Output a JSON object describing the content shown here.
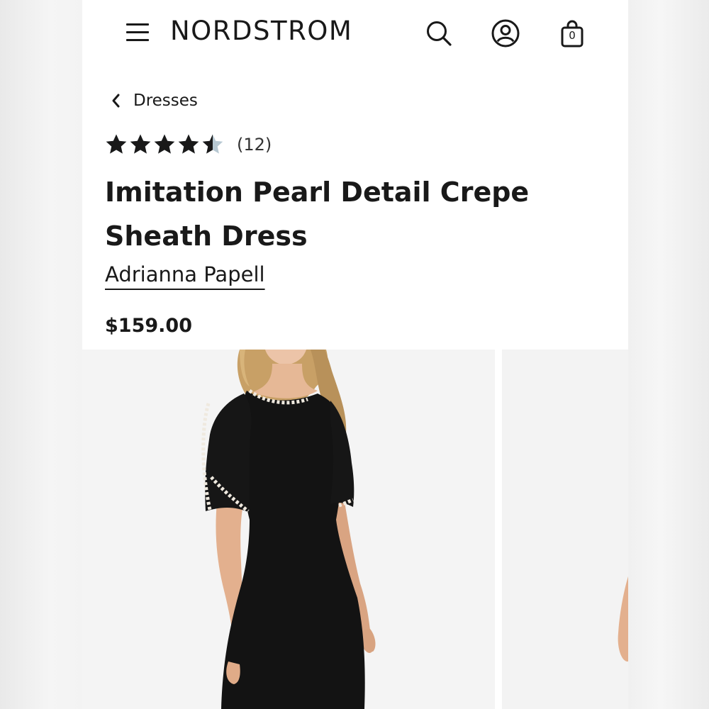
{
  "header": {
    "logo": "NORDSTROM",
    "bag_count": "0",
    "icons": [
      "menu-icon",
      "search-icon",
      "account-icon",
      "shopping-bag-icon"
    ]
  },
  "breadcrumb": {
    "label": "Dresses"
  },
  "product": {
    "rating": 4.5,
    "max_rating": 5,
    "review_count": "(12)",
    "title": "Imitation Pearl Detail Crepe Sheath Dress",
    "brand": "Adrianna Papell",
    "price": "$159.00"
  },
  "gallery": {
    "images": [
      "main-product-image",
      "next-product-image"
    ]
  },
  "colors": {
    "text": "#191919",
    "star_filled": "#191919",
    "star_empty": "#b7c8d2",
    "dress": "#131313",
    "pearl": "#efe9df"
  }
}
